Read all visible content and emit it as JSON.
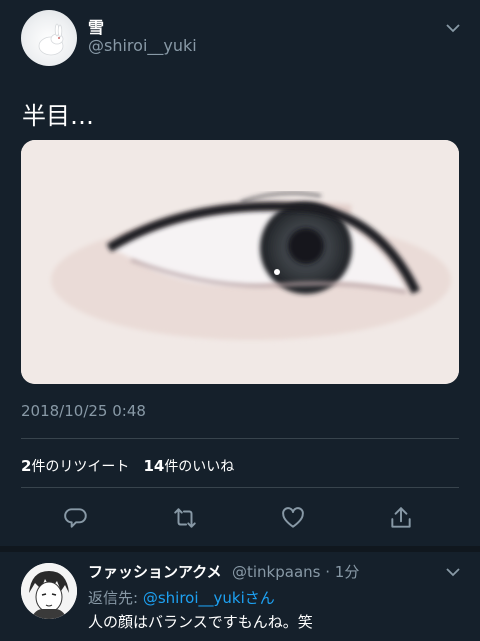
{
  "tweet": {
    "display_name": "雪",
    "handle": "@shiroi__yuki",
    "text": "半目…",
    "timestamp": "2018/10/25 0:48",
    "retweet_count": "2",
    "retweet_label": "件のリツイート",
    "like_count": "14",
    "like_label": "件のいいね"
  },
  "actions": {
    "icons": [
      "reply-icon",
      "retweet-icon",
      "like-icon",
      "share-icon"
    ]
  },
  "reply": {
    "display_name": "ファッションアクメ",
    "handle_time": "@tinkpaans · 1分",
    "replying_prefix": "返信先: ",
    "replying_to": "@shiroi__yuki",
    "replying_suffix": "さん",
    "text": "人の顔はバランスですもんね。笑"
  },
  "colors": {
    "background": "#15202b",
    "secondary_text": "#8899a6",
    "link": "#1da1f2",
    "divider": "#38444d"
  }
}
